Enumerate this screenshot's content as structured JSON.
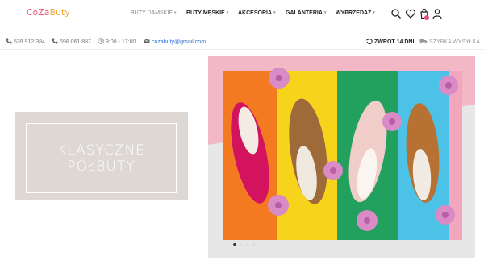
{
  "brand": {
    "logo_part1": "CoZa",
    "logo_part2": "Buty"
  },
  "nav": {
    "items": [
      {
        "label": "BUTY DAMSKIE",
        "active": true
      },
      {
        "label": "BUTY MĘSKIE",
        "active": false
      },
      {
        "label": "AKCESORIA",
        "active": false
      },
      {
        "label": "GALANTERIA",
        "active": false
      },
      {
        "label": "WYPRZEDAŻ",
        "active": false
      }
    ]
  },
  "header_icons": [
    "search-icon",
    "heart-icon",
    "cart-icon",
    "user-icon"
  ],
  "info": {
    "phone1": "539 912 384",
    "phone2": "698 061 887",
    "hours": "9:00 - 17:00",
    "email": "cozabuty@gmail.com",
    "return": "ZWROT 14 DNI",
    "shipping": "SZYBKA WYSYŁKA"
  },
  "hero": {
    "line1": "KLASYCZNE",
    "line2": "PÓŁBUTY",
    "slides": 4,
    "active_slide": 1
  },
  "colors": {
    "accent_pink": "#e94e78",
    "accent_orange": "#f0a53a",
    "hero_box": "#ddd8d4",
    "email_link": "#2c6fd6"
  }
}
